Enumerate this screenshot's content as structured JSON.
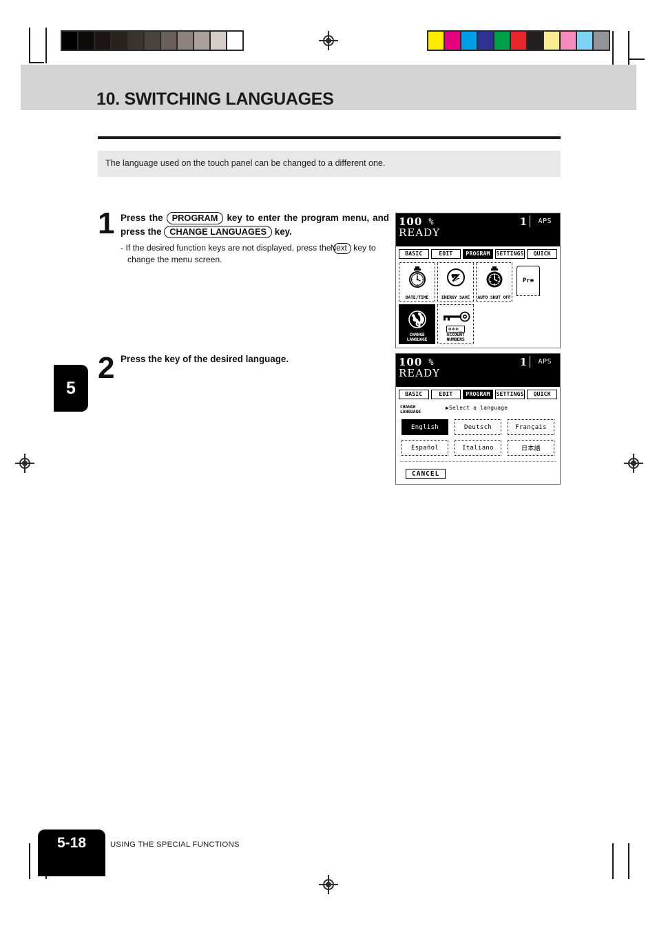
{
  "document": {
    "chapter_tab": "5",
    "page_number": "5-18",
    "footer_label": "USING THE SPECIAL FUNCTIONS",
    "section_title": "10. SWITCHING LANGUAGES",
    "intro": "The language used on the touch panel can be changed to a different one."
  },
  "print_marks": {
    "gray_wedge": [
      "#000000",
      "#0d0a0a",
      "#1b1513",
      "#28211d",
      "#3a322e",
      "#4b4240",
      "#6a5f5c",
      "#8d827f",
      "#aaa09e",
      "#d6cdca",
      "#ffffff"
    ],
    "color_bar": [
      "#fdec00",
      "#e5007e",
      "#00a0e9",
      "#2e3192",
      "#00a04a",
      "#e8252a",
      "#231f20",
      "#faed91",
      "#f68bbd",
      "#7fd4f5",
      "#939598"
    ]
  },
  "steps": [
    {
      "num": "1",
      "lead_parts": [
        {
          "type": "text",
          "text": "Press the "
        },
        {
          "type": "key",
          "text": "PROGRAM"
        },
        {
          "type": "text",
          "text": " key to enter the program menu, and press the "
        },
        {
          "type": "key",
          "text": "CHANGE LANGUAGES"
        },
        {
          "type": "text",
          "text": " key."
        }
      ],
      "sub_parts": [
        {
          "type": "text",
          "text": "- If the desired function keys are not displayed, press the "
        },
        {
          "type": "key_small",
          "text": "Next"
        },
        {
          "type": "text",
          "text": " key to change the menu screen."
        }
      ]
    },
    {
      "num": "2",
      "lead_parts": [
        {
          "type": "text",
          "text": "Press the key of the desired language."
        }
      ],
      "sub_parts": []
    }
  ],
  "panel_program": {
    "status": {
      "zoom": "100",
      "percent": "%",
      "copy_count": "1",
      "paper_mode": "APS",
      "ready": "READY"
    },
    "tabs": [
      {
        "label": "BASIC",
        "active": false
      },
      {
        "label": "EDIT",
        "active": false
      },
      {
        "label": "PROGRAM",
        "active": true
      },
      {
        "label": "SETTINGS",
        "active": false
      },
      {
        "label": "QUICK",
        "active": false
      }
    ],
    "function_keys": [
      {
        "label": "DATE/TIME",
        "icon": "stopwatch-icon",
        "selected": false
      },
      {
        "label": "ENERGY SAVE",
        "icon": "energy-save-icon",
        "selected": false
      },
      {
        "label": "AUTO SHUT OFF",
        "icon": "pocket-watch-icon",
        "selected": false
      },
      {
        "label": "CHANGE LANGUAGE",
        "icon": "globe-icon",
        "selected": true
      },
      {
        "label": "ACCOUNT NUMBERS",
        "icon": "key-icon",
        "selected": false
      }
    ],
    "account_field_value": "✻✻✻_",
    "next_tab_label": "Pre"
  },
  "panel_language": {
    "status": {
      "zoom": "100",
      "percent": "%",
      "copy_count": "1",
      "paper_mode": "APS",
      "ready": "READY"
    },
    "tabs": [
      {
        "label": "BASIC",
        "active": false
      },
      {
        "label": "EDIT",
        "active": false
      },
      {
        "label": "PROGRAM",
        "active": true
      },
      {
        "label": "SETTINGS",
        "active": false
      },
      {
        "label": "QUICK",
        "active": false
      }
    ],
    "mode_label_line1": "CHANGE",
    "mode_label_line2": "LANGUAGE",
    "prompt": "▶Select a language",
    "languages": [
      {
        "label": "English",
        "selected": true
      },
      {
        "label": "Deutsch",
        "selected": false
      },
      {
        "label": "Français",
        "selected": false
      },
      {
        "label": "Español",
        "selected": false
      },
      {
        "label": "Italiano",
        "selected": false
      },
      {
        "label": "日本語",
        "selected": false
      }
    ],
    "cancel_label": "CANCEL"
  }
}
